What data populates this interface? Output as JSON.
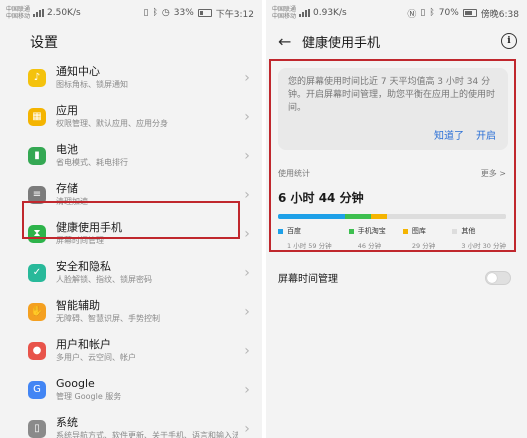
{
  "left": {
    "status": {
      "carrier1": "中国联通",
      "carrier2": "中国移动",
      "speed": "2.50K/s",
      "battery": "33%",
      "time": "下午3:12"
    },
    "title": "设置",
    "items": [
      {
        "title": "通知中心",
        "sub": "图标角标、锁屏通知",
        "icon": "bell-icon",
        "color": "#f4c20d"
      },
      {
        "title": "应用",
        "sub": "权限管理、默认应用、应用分身",
        "icon": "apps-grid-icon",
        "color": "#f4b400"
      },
      {
        "title": "电池",
        "sub": "省电模式、耗电排行",
        "icon": "battery-icon",
        "color": "#34a853"
      },
      {
        "title": "存储",
        "sub": "清理加速",
        "icon": "storage-icon",
        "color": "#7b7b7b"
      },
      {
        "title": "健康使用手机",
        "sub": "屏幕时间管理",
        "icon": "hourglass-icon",
        "color": "#2db34a"
      },
      {
        "title": "安全和隐私",
        "sub": "人脸解锁、指纹、锁屏密码",
        "icon": "shield-icon",
        "color": "#28b99a"
      },
      {
        "title": "智能辅助",
        "sub": "无障碍、智慧识屏、手势控制",
        "icon": "hand-icon",
        "color": "#f4a020"
      },
      {
        "title": "用户和帐户",
        "sub": "多用户、云空间、帐户",
        "icon": "user-icon",
        "color": "#e8534a"
      },
      {
        "title": "Google",
        "sub": "管理 Google 服务",
        "icon": "google-icon",
        "color": "#4285f4"
      },
      {
        "title": "系统",
        "sub": "系统导航方式、软件更新、关于手机、语言和输入法",
        "icon": "phone-icon",
        "color": "#8a8a8a"
      }
    ]
  },
  "right": {
    "status": {
      "carrier1": "中国联通",
      "carrier2": "中国移动",
      "speed": "0.93K/s",
      "battery": "70%",
      "time": "傍晚6:38"
    },
    "title": "健康使用手机",
    "card": {
      "message": "您的屏幕使用时间比近 7 天平均值高 3 小时 34 分钟。开启屏幕时间管理，助您平衡在应用上的使用时间。",
      "dismiss": "知道了",
      "enable": "开启"
    },
    "usage": {
      "label": "使用统计",
      "more": "更多 >",
      "total": "6 小时 44 分钟",
      "apps": [
        {
          "name": "百度",
          "time": "1 小时 59 分钟",
          "minutes": 119,
          "color": "#1ea0e8"
        },
        {
          "name": "手机淘宝",
          "time": "46 分钟",
          "minutes": 46,
          "color": "#3dbf4f"
        },
        {
          "name": "图库",
          "time": "29 分钟",
          "minutes": 29,
          "color": "#f4b400"
        },
        {
          "name": "其他",
          "time": "3 小时 30 分钟",
          "minutes": 210,
          "color": "#dddddd"
        }
      ]
    },
    "screen_time_label": "屏幕时间管理"
  }
}
